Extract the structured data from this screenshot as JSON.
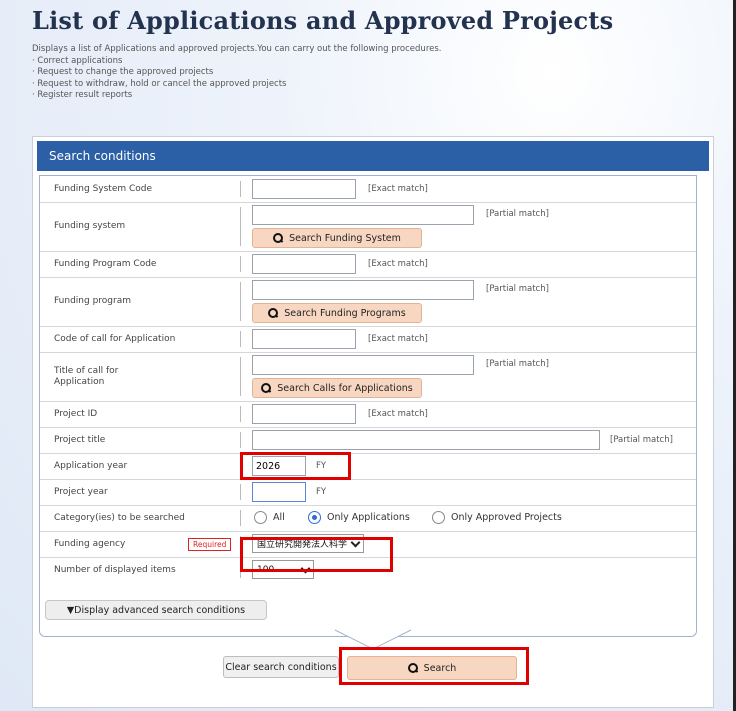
{
  "page": {
    "title": "List of Applications and Approved Projects",
    "description": "Displays a list of Applications and approved projects.You can carry out the following procedures.",
    "procedures": [
      "· Correct applications",
      "· Request to change the approved projects",
      "· Request to withdraw, hold or cancel the approved projects",
      "· Register result reports"
    ]
  },
  "search": {
    "header": "Search conditions",
    "fields": {
      "funding_system_code": {
        "label": "Funding System Code",
        "value": "",
        "match": "[Exact match]"
      },
      "funding_system": {
        "label": "Funding system",
        "value": "",
        "match": "[Partial match]",
        "button": "Search Funding System"
      },
      "funding_program_code": {
        "label": "Funding Program Code",
        "value": "",
        "match": "[Exact match]"
      },
      "funding_program": {
        "label": "Funding program",
        "value": "",
        "match": "[Partial match]",
        "button": "Search Funding Programs"
      },
      "call_code": {
        "label": "Code of call for Application",
        "value": "",
        "match": "[Exact match]"
      },
      "call_title": {
        "label": "Title of call for Application",
        "value": "",
        "match": "[Partial match]",
        "button": "Search Calls for Applications"
      },
      "project_id": {
        "label": "Project ID",
        "value": "",
        "match": "[Exact match]"
      },
      "project_title": {
        "label": "Project title",
        "value": "",
        "match": "[Partial match]"
      },
      "application_year": {
        "label": "Application year",
        "value": "2026",
        "unit": "FY"
      },
      "project_year": {
        "label": "Project year",
        "value": "",
        "unit": "FY"
      },
      "category": {
        "label": "Category(ies) to be searched",
        "options": [
          "All",
          "Only Applications",
          "Only Approved Projects"
        ],
        "selected": "Only Applications"
      },
      "funding_agency": {
        "label": "Funding agency",
        "required": "Required",
        "value": "国立研究開発法人科学"
      },
      "displayed_items": {
        "label": "Number of displayed items",
        "value": "100"
      }
    },
    "advanced_button": "▼Display advanced search conditions",
    "clear_button": "Clear search conditions",
    "search_button": "Search"
  },
  "colors": {
    "header": "#2b5fa6",
    "button_accent": "#f8d7c2",
    "highlight": "#e00000",
    "title": "#23324e"
  }
}
